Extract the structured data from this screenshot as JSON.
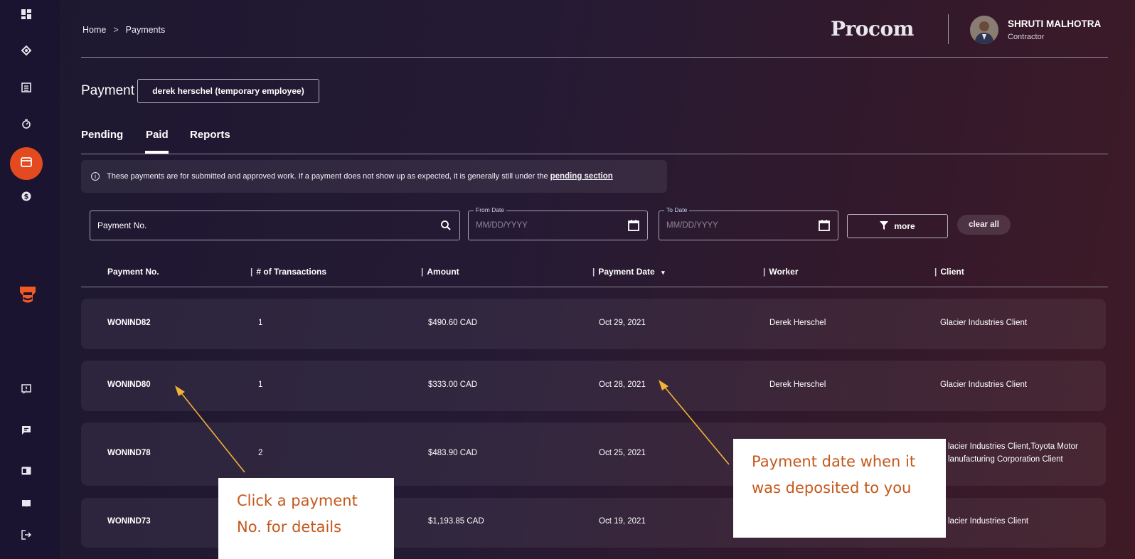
{
  "breadcrumb": {
    "home": "Home",
    "separator": ">",
    "current": "Payments"
  },
  "brand": {
    "name": "Procom"
  },
  "user": {
    "name": "SHRUTI MALHOTRA",
    "role": "Contractor"
  },
  "page": {
    "label": "Payment",
    "selected_worker": "derek herschel (temporary employee)"
  },
  "tabs": [
    {
      "label": "Pending",
      "active": false
    },
    {
      "label": "Paid",
      "active": true
    },
    {
      "label": "Reports",
      "active": false
    }
  ],
  "info": {
    "text": "These payments are for submitted and approved work. If a payment does not show up as expected, it is generally still under the",
    "link": "pending section"
  },
  "filters": {
    "payment_no_placeholder": "Payment No.",
    "from_date": {
      "legend": "From Date",
      "placeholder": "MM/DD/YYYY"
    },
    "to_date": {
      "legend": "To Date",
      "placeholder": "MM/DD/YYYY"
    },
    "more_label": "more",
    "clear_label": "clear all"
  },
  "table": {
    "columns": [
      "Payment No.",
      "# of Transactions",
      "Amount",
      "Payment Date",
      "Worker",
      "Client"
    ],
    "sorted_column": "Payment Date",
    "rows": [
      {
        "payment_no": "WONIND82",
        "transactions": "1",
        "amount": "$490.60 CAD",
        "date": "Oct 29, 2021",
        "worker": "Derek Herschel",
        "client": "Glacier Industries Client"
      },
      {
        "payment_no": "WONIND80",
        "transactions": "1",
        "amount": "$333.00 CAD",
        "date": "Oct 28, 2021",
        "worker": "Derek Herschel",
        "client": "Glacier Industries Client"
      },
      {
        "payment_no": "WONIND78",
        "transactions": "2",
        "amount": "$483.90 CAD",
        "date": "Oct 25, 2021",
        "worker": "",
        "client": "lacier Industries Client,Toyota Motor lanufacturing Corporation Client"
      },
      {
        "payment_no": "WONIND73",
        "transactions": "",
        "amount": "$1,193.85 CAD",
        "date": "Oct 19, 2021",
        "worker": "",
        "client": "lacier Industries Client"
      }
    ]
  },
  "callouts": {
    "payment_no": "Click a payment No. for details",
    "payment_date": "Payment date when it was deposited to you"
  },
  "colors": {
    "accent": "#e34a1f",
    "callout_text": "#c4581b",
    "callout_arrow": "#f2b233"
  }
}
